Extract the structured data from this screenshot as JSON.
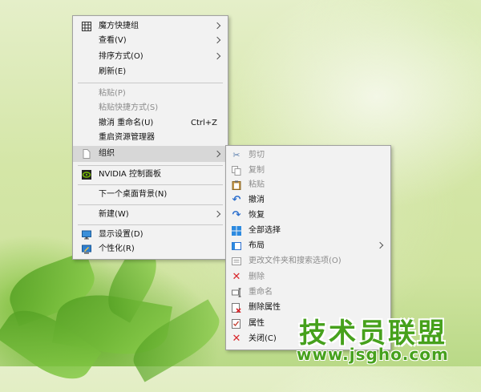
{
  "main_menu": {
    "items": [
      {
        "label": "魔方快捷组",
        "icon": "grid-icon",
        "submenu": true,
        "disabled": false
      },
      {
        "label": "查看(V)",
        "submenu": true,
        "disabled": false
      },
      {
        "label": "排序方式(O)",
        "submenu": true,
        "disabled": false
      },
      {
        "label": "刷新(E)",
        "disabled": false
      },
      {
        "label": "粘贴(P)",
        "disabled": true
      },
      {
        "label": "粘贴快捷方式(S)",
        "disabled": true
      },
      {
        "label": "撤消 重命名(U)",
        "shortcut": "Ctrl+Z",
        "disabled": false
      },
      {
        "label": "重启资源管理器",
        "disabled": false
      },
      {
        "label": "组织",
        "icon": "document-icon",
        "submenu": true,
        "highlighted": true
      },
      {
        "label": "NVIDIA 控制面板",
        "icon": "nvidia-icon",
        "disabled": false
      },
      {
        "label": "下一个桌面背景(N)",
        "disabled": false
      },
      {
        "label": "新建(W)",
        "submenu": true,
        "disabled": false
      },
      {
        "label": "显示设置(D)",
        "icon": "monitor-icon",
        "disabled": false
      },
      {
        "label": "个性化(R)",
        "icon": "personalize-icon",
        "disabled": false
      }
    ]
  },
  "sub_menu": {
    "items": [
      {
        "label": "剪切",
        "icon": "scissors-icon",
        "disabled": true
      },
      {
        "label": "复制",
        "icon": "copy-icon",
        "disabled": true
      },
      {
        "label": "粘贴",
        "icon": "clipboard-icon",
        "disabled": true
      },
      {
        "label": "撤消",
        "icon": "undo-icon",
        "disabled": false
      },
      {
        "label": "恢复",
        "icon": "redo-icon",
        "disabled": false
      },
      {
        "label": "全部选择",
        "icon": "select-all-icon",
        "disabled": false
      },
      {
        "label": "布局",
        "icon": "layout-icon",
        "submenu": true,
        "disabled": false
      },
      {
        "label": "更改文件夹和搜索选项(O)",
        "icon": "folder-options-icon",
        "disabled": true
      },
      {
        "label": "删除",
        "icon": "delete-icon",
        "disabled": true
      },
      {
        "label": "重命名",
        "icon": "rename-icon",
        "disabled": true
      },
      {
        "label": "删除属性",
        "icon": "remove-properties-icon",
        "disabled": false
      },
      {
        "label": "属性",
        "icon": "properties-icon",
        "disabled": false
      },
      {
        "label": "关闭(C)",
        "icon": "close-icon",
        "disabled": false
      }
    ]
  },
  "watermark": {
    "title": "技术员联盟",
    "url": "www.jsgho.com"
  }
}
